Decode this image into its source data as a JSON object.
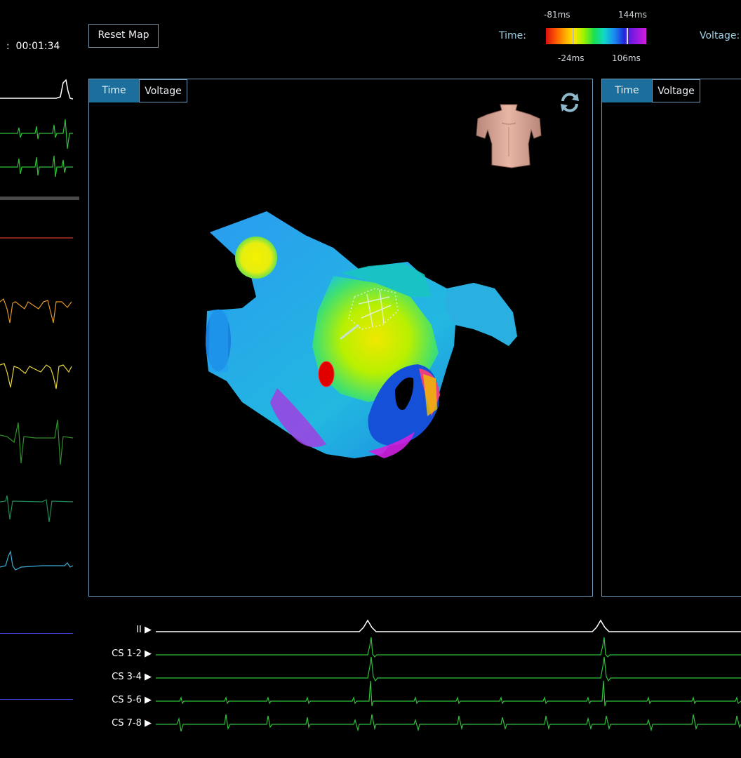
{
  "header": {
    "timer_prefix": ":",
    "timer": "00:01:34",
    "reset_button": "Reset Map",
    "time_label": "Time:",
    "voltage_label": "Voltage:",
    "colorbar": {
      "top_left": "-81ms",
      "top_right": "144ms",
      "bottom_left": "-24ms",
      "bottom_right": "106ms"
    }
  },
  "main_panel": {
    "tabs": [
      "Time",
      "Voltage"
    ],
    "active_tab": "Time"
  },
  "right_panel": {
    "tabs": [
      "Time",
      "Voltage"
    ],
    "active_tab": "Time"
  },
  "channels": [
    {
      "label": "II",
      "color": "#ffffff"
    },
    {
      "label": "CS 1-2",
      "color": "#2fbf3a"
    },
    {
      "label": "CS 3-4",
      "color": "#2fbf3a"
    },
    {
      "label": "CS 5-6",
      "color": "#2fbf3a"
    },
    {
      "label": "CS 7-8",
      "color": "#2fbf3a"
    }
  ],
  "left_traces": [
    {
      "color": "#ffffff"
    },
    {
      "color": "#2fbf3a"
    },
    {
      "color": "#2fbf3a"
    },
    {
      "color": "#d33a2a"
    },
    {
      "color": "#e0962a"
    },
    {
      "color": "#e6d43a"
    },
    {
      "color": "#2f8f2a"
    },
    {
      "color": "#1f8a55"
    },
    {
      "color": "#39aed8"
    },
    {
      "color": "#3a45d8"
    },
    {
      "color": "#3a45d8"
    }
  ],
  "icons": {
    "refresh": "refresh-icon",
    "torso": "torso-orientation-icon",
    "play": "play-triangle-icon"
  }
}
